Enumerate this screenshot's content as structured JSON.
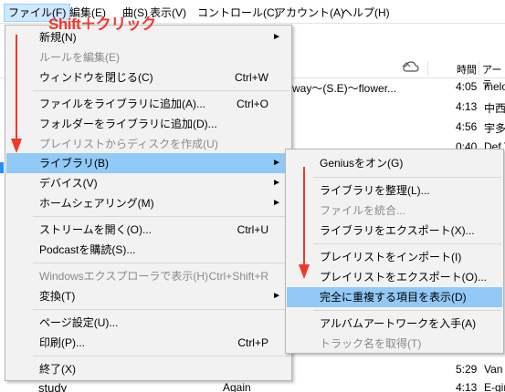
{
  "menubar": {
    "items": [
      "ファイル(F)",
      "編集(E)",
      "曲(S)",
      "表示(V)",
      "コントロール(C)",
      "アカウント(A)",
      "ヘルプ(H)"
    ]
  },
  "annotation": {
    "text": "Shift＋クリック",
    "color": "#f5352a"
  },
  "background": {
    "columns": [
      "時間",
      "アーテ"
    ],
    "rows": [
      {
        "title": "way〜(S.E)〜flower...",
        "time": "4:05",
        "artist": "melo"
      },
      {
        "title": "",
        "time": "4:13",
        "artist": "中西"
      },
      {
        "title": "",
        "time": "4:56",
        "artist": "宇多"
      },
      {
        "title": "",
        "time": "0:40",
        "artist": "Def T"
      },
      {
        "title": "",
        "time": "5:29",
        "artist": "Van"
      },
      {
        "title": "Again",
        "time": "4:13",
        "artist": "E-gir"
      }
    ],
    "sidebar_item": "study"
  },
  "file_menu": {
    "items": [
      {
        "label": "新規(N)",
        "shortcut": "",
        "submenu": true,
        "disabled": false
      },
      {
        "label": "ルールを編集(E)",
        "shortcut": "",
        "submenu": false,
        "disabled": true
      },
      {
        "label": "ウィンドウを閉じる(C)",
        "shortcut": "Ctrl+W",
        "submenu": false,
        "disabled": false
      },
      {
        "label": "ファイルをライブラリに追加(A)...",
        "shortcut": "Ctrl+O",
        "submenu": false,
        "disabled": false
      },
      {
        "label": "フォルダーをライブラリに追加(D)...",
        "shortcut": "",
        "submenu": false,
        "disabled": false
      },
      {
        "label": "プレイリストからディスクを作成(U)",
        "shortcut": "",
        "submenu": false,
        "disabled": true
      },
      {
        "label": "ライブラリ(B)",
        "shortcut": "",
        "submenu": true,
        "disabled": false,
        "highlighted": true
      },
      {
        "label": "デバイス(V)",
        "shortcut": "",
        "submenu": true,
        "disabled": false
      },
      {
        "label": "ホームシェアリング(M)",
        "shortcut": "",
        "submenu": true,
        "disabled": false
      },
      {
        "label": "ストリームを開く(O)...",
        "shortcut": "Ctrl+U",
        "submenu": false,
        "disabled": false
      },
      {
        "label": "Podcastを購読(S)...",
        "shortcut": "",
        "submenu": false,
        "disabled": false
      },
      {
        "label": "Windowsエクスプローラで表示(H)",
        "shortcut": "Ctrl+Shift+R",
        "submenu": false,
        "disabled": true
      },
      {
        "label": "変換(T)",
        "shortcut": "",
        "submenu": true,
        "disabled": false
      },
      {
        "label": "ページ設定(U)...",
        "shortcut": "",
        "submenu": false,
        "disabled": false
      },
      {
        "label": "印刷(P)...",
        "shortcut": "Ctrl+P",
        "submenu": false,
        "disabled": false
      },
      {
        "label": "終了(X)",
        "shortcut": "",
        "submenu": false,
        "disabled": false
      }
    ]
  },
  "library_menu": {
    "items": [
      {
        "label": "Geniusをオン(G)",
        "disabled": false
      },
      {
        "label": "ライブラリを整理(L)...",
        "disabled": false
      },
      {
        "label": "ファイルを統合...",
        "disabled": true
      },
      {
        "label": "ライブラリをエクスポート(X)...",
        "disabled": false
      },
      {
        "label": "プレイリストをインポート(I)",
        "disabled": false
      },
      {
        "label": "プレイリストをエクスポート(O)...",
        "disabled": false
      },
      {
        "label": "完全に重複する項目を表示(D)",
        "disabled": false,
        "highlighted": true
      },
      {
        "label": "アルバムアートワークを入手(A)",
        "disabled": false
      },
      {
        "label": "トラック名を取得(T)",
        "disabled": true
      }
    ]
  }
}
